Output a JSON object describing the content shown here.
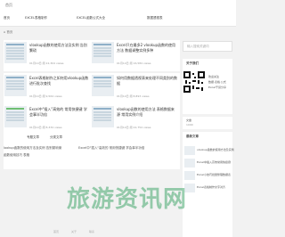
{
  "header": {
    "logo_text": "首页",
    "nav": [
      "首页",
      "EXCEL表格制作",
      "EXCEL函数公式大全",
      "数据透视表"
    ]
  },
  "breadcrumb": "首页",
  "cards": [
    {
      "title": "vlookup函数的使用方法及实例 告别繁琐",
      "meta": "01月14日 阅 22,304 views"
    },
    {
      "title": "Excel只在最多2 vlookup函数的使用方法 数据调整实例多种",
      "meta": "01月14日 阅 16,584 views"
    },
    {
      "title": "Excel表格制作之如何用vlookup函数进行批次查找",
      "meta": "01月14日 阅 9,564 views"
    },
    {
      "title": "如何用数据透视表来处理不同类别的数据",
      "meta": "01月14日 阅 8,893 views"
    },
    {
      "title": "Excel中\"插入\"高效的 常用快捷键 学会事半功倍",
      "meta": "01月14日 阅 8,334 views"
    },
    {
      "title": "vlookup函数的使用方法 表格数据来源 常用实例介绍",
      "meta": "01月14日 阅 22,754 views"
    }
  ],
  "tabs": [
    "专题文章",
    "分类文章"
  ],
  "bottom_links": [
    "lookup函数的使用方法及实例 告别繁琐案",
    "Excel中\"插入\"高效的 常用快捷键 学会事半功倍",
    "函数使用技巧 表格"
  ],
  "sidebar": {
    "search_placeholder": "输入搜索关键词",
    "about_title": "关于我们",
    "about_lines": [
      "欢迎关注",
      "数据·表格·公式",
      "Excel干货分享"
    ],
    "counter_label": "文章",
    "counter_value": "1090",
    "recent_title": "最新文章",
    "recent": [
      "vlookup函数的使用方法及实例",
      "Excel中插入高效常用快捷键",
      "Excel小技巧批量整理数据表",
      "Excel表格制作文字对齐"
    ]
  },
  "watermark": "旅游资讯网",
  "footer": [
    "首页",
    "关于",
    "联系"
  ]
}
